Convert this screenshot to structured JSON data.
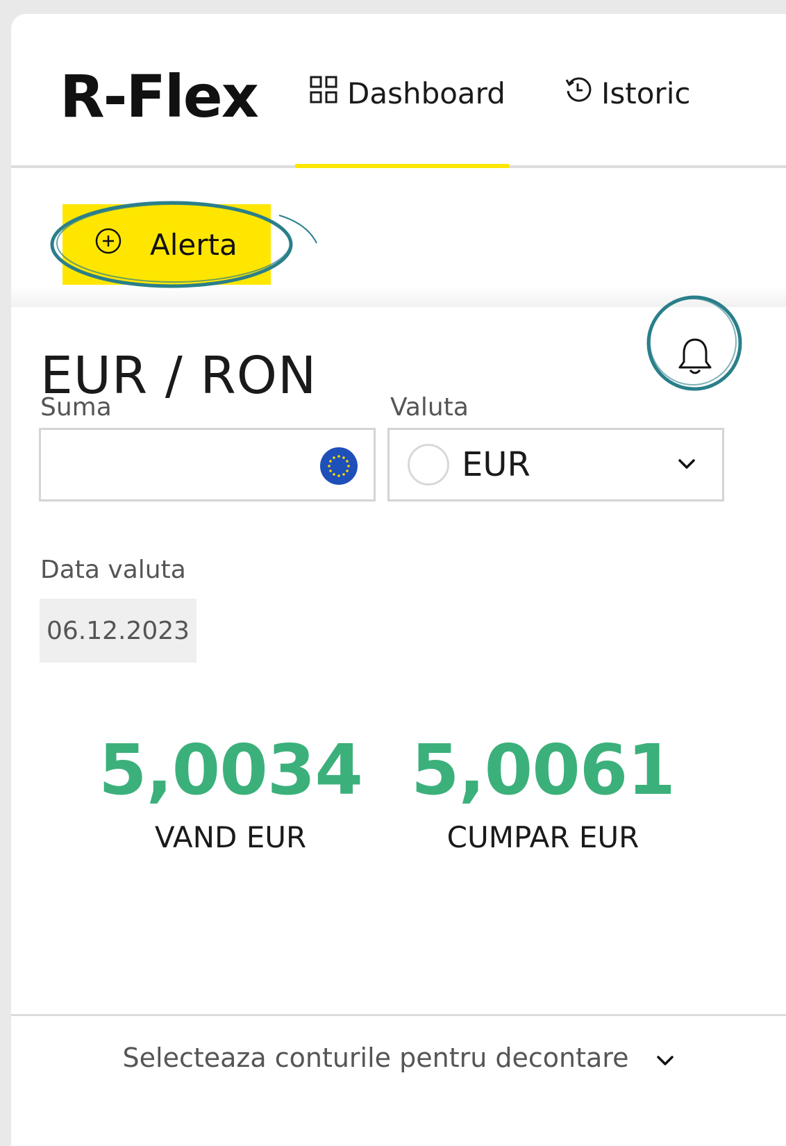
{
  "app": {
    "title": "R-Flex"
  },
  "nav": {
    "tabs": [
      {
        "label": "Dashboard",
        "icon": "grid-icon",
        "active": true
      },
      {
        "label": "Istoric",
        "icon": "history-clock-icon",
        "active": false
      }
    ]
  },
  "toolbar": {
    "alert_label": "Alerta",
    "alert_icon": "plus-circle-icon"
  },
  "main": {
    "pair": "EUR / RON",
    "amount": {
      "label": "Suma",
      "value": "",
      "flag_icon": "eu-flag-icon"
    },
    "currency": {
      "label": "Valuta",
      "selected": "EUR"
    },
    "value_date": {
      "label": "Data valuta",
      "value": "06.12.2023"
    },
    "rates": [
      {
        "value": "5,0034",
        "label": "VAND EUR"
      },
      {
        "value": "5,0061",
        "label": "CUMPAR EUR"
      }
    ]
  },
  "footer": {
    "settlement_label": "Selecteaza conturile pentru decontare"
  },
  "colors": {
    "accent": "#ffe600",
    "rate": "#3cb07b",
    "annotation": "#2a7f8a"
  }
}
